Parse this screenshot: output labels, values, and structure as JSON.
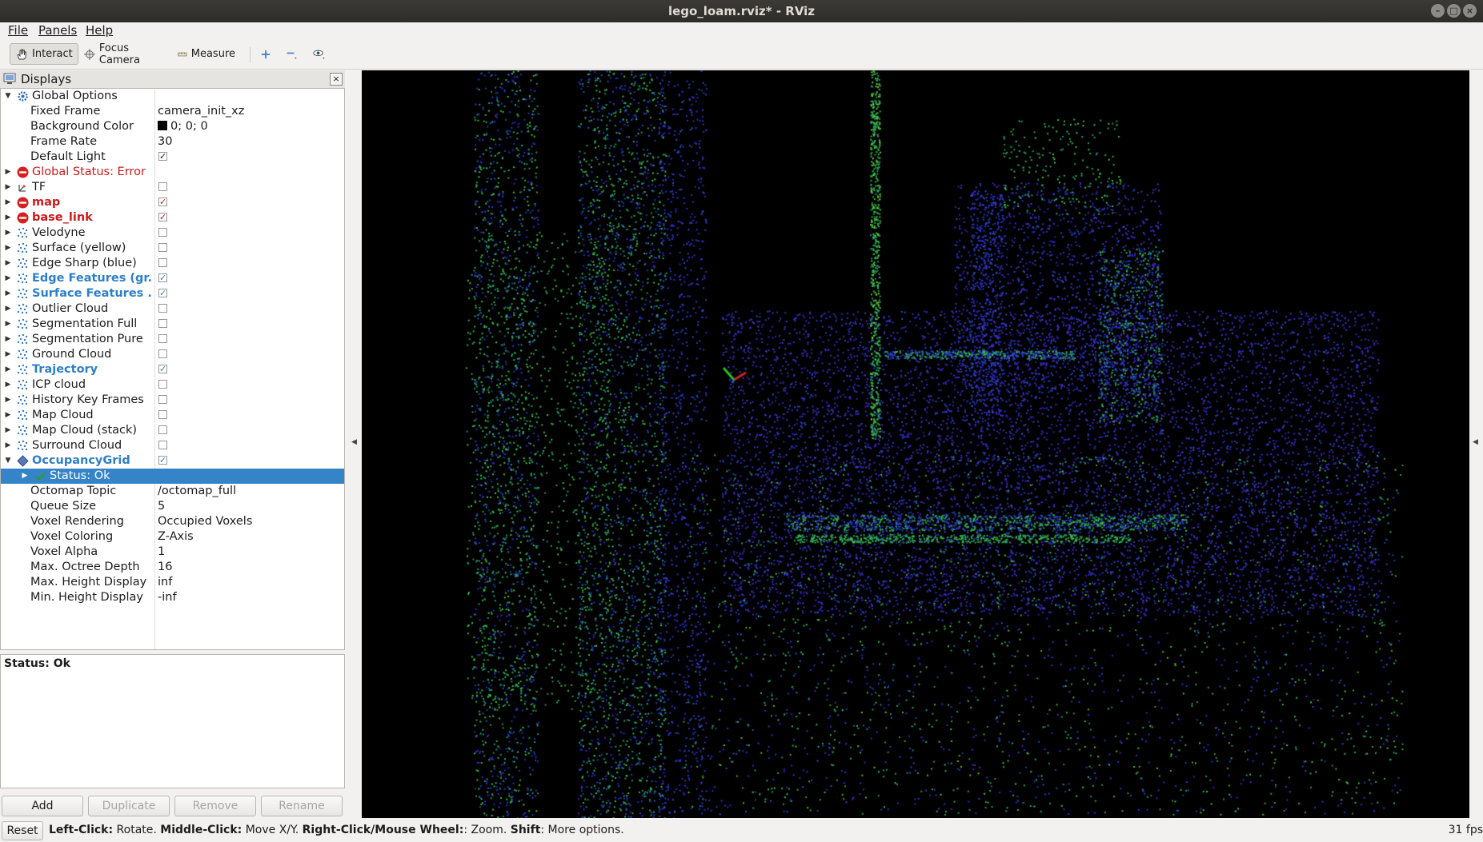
{
  "window": {
    "title": "lego_loam.rviz* - RViz"
  },
  "menu": {
    "file": "File",
    "panels": "Panels",
    "help": "Help"
  },
  "toolbar": {
    "interact": "Interact",
    "focus_camera": "Focus Camera",
    "measure": "Measure"
  },
  "displays": {
    "title": "Displays",
    "rows": [
      {
        "label": "Global Options",
        "style": "normal",
        "indent": 0,
        "expanded": true,
        "icon": "gear-icon"
      },
      {
        "label": "Fixed Frame",
        "value": "camera_init_xz",
        "indent": 1
      },
      {
        "label": "Background Color",
        "value": "0; 0; 0",
        "indent": 1,
        "swatch": "#000000"
      },
      {
        "label": "Frame Rate",
        "value": "30",
        "indent": 1
      },
      {
        "label": "Default Light",
        "indent": 1,
        "checked": true
      },
      {
        "label": "Global Status: Error",
        "style": "error",
        "indent": 0,
        "icon": "error-icon"
      },
      {
        "label": "TF",
        "indent": 0,
        "icon": "tf-icon",
        "checked": false
      },
      {
        "label": "map",
        "style": "errorbold",
        "indent": 0,
        "icon": "error-icon",
        "checked": true
      },
      {
        "label": "base_link",
        "style": "errorbold",
        "indent": 0,
        "icon": "error-icon",
        "checked": true
      },
      {
        "label": "Velodyne",
        "indent": 0,
        "icon": "pointcloud-icon",
        "checked": false
      },
      {
        "label": "Surface (yellow)",
        "indent": 0,
        "icon": "pointcloud-icon",
        "checked": false
      },
      {
        "label": "Edge Sharp (blue)",
        "indent": 0,
        "icon": "pointcloud-icon",
        "checked": false
      },
      {
        "label": "Edge Features (gr...",
        "style": "bluebold",
        "indent": 0,
        "icon": "pointcloud-icon",
        "checked": true
      },
      {
        "label": "Surface Features ...",
        "style": "bluebold",
        "indent": 0,
        "icon": "pointcloud-icon",
        "checked": true
      },
      {
        "label": "Outlier Cloud",
        "indent": 0,
        "icon": "pointcloud-icon",
        "checked": false
      },
      {
        "label": "Segmentation Full",
        "indent": 0,
        "icon": "pointcloud-icon",
        "checked": false
      },
      {
        "label": "Segmentation Pure",
        "indent": 0,
        "icon": "pointcloud-icon",
        "checked": false
      },
      {
        "label": "Ground Cloud",
        "indent": 0,
        "icon": "pointcloud-icon",
        "checked": false
      },
      {
        "label": "Trajectory",
        "style": "bluebold",
        "indent": 0,
        "icon": "pointcloud-icon",
        "checked": true
      },
      {
        "label": "ICP cloud",
        "indent": 0,
        "icon": "pointcloud-icon",
        "checked": false
      },
      {
        "label": "History Key Frames",
        "indent": 0,
        "icon": "pointcloud-icon",
        "checked": false
      },
      {
        "label": "Map Cloud",
        "indent": 0,
        "icon": "pointcloud-icon",
        "checked": false
      },
      {
        "label": "Map Cloud (stack)",
        "indent": 0,
        "icon": "pointcloud-icon",
        "checked": false
      },
      {
        "label": "Surround Cloud",
        "indent": 0,
        "icon": "pointcloud-icon",
        "checked": false
      },
      {
        "label": "OccupancyGrid",
        "style": "bluebold",
        "indent": 0,
        "expanded": true,
        "icon": "occupancy-icon",
        "checked": true
      },
      {
        "label": "Status: Ok",
        "indent": 1,
        "selected": true,
        "icon": "check-icon"
      },
      {
        "label": "Octomap Topic",
        "value": "/octomap_full",
        "indent": 1
      },
      {
        "label": "Queue Size",
        "value": "5",
        "indent": 1
      },
      {
        "label": "Voxel Rendering",
        "value": "Occupied Voxels",
        "indent": 1
      },
      {
        "label": "Voxel Coloring",
        "value": "Z-Axis",
        "indent": 1
      },
      {
        "label": "Voxel Alpha",
        "value": "1",
        "indent": 1
      },
      {
        "label": "Max. Octree Depth",
        "value": "16",
        "indent": 1
      },
      {
        "label": "Max. Height Display",
        "value": "inf",
        "indent": 1
      },
      {
        "label": "Min. Height Display",
        "value": "-inf",
        "indent": 1
      }
    ],
    "status": "Status: Ok",
    "buttons": {
      "add": "Add",
      "duplicate": "Duplicate",
      "remove": "Remove",
      "rename": "Rename"
    }
  },
  "statusbar": {
    "reset": "Reset",
    "hint_parts": [
      {
        "text": "Left-Click:",
        "bold": true
      },
      {
        "text": " Rotate. ",
        "bold": false
      },
      {
        "text": "Middle-Click:",
        "bold": true
      },
      {
        "text": " Move X/Y. ",
        "bold": false
      },
      {
        "text": "Right-Click/Mouse Wheel:",
        "bold": true
      },
      {
        "text": ": Zoom. ",
        "bold": false
      },
      {
        "text": "Shift",
        "bold": true
      },
      {
        "text": ": More options.",
        "bold": false
      }
    ],
    "fps": "31 fps"
  },
  "colors": {
    "error": "#cc1a1a",
    "highlight": "#2e7fc9",
    "selection": "#3584c8",
    "viewport_bg": "#000000"
  }
}
